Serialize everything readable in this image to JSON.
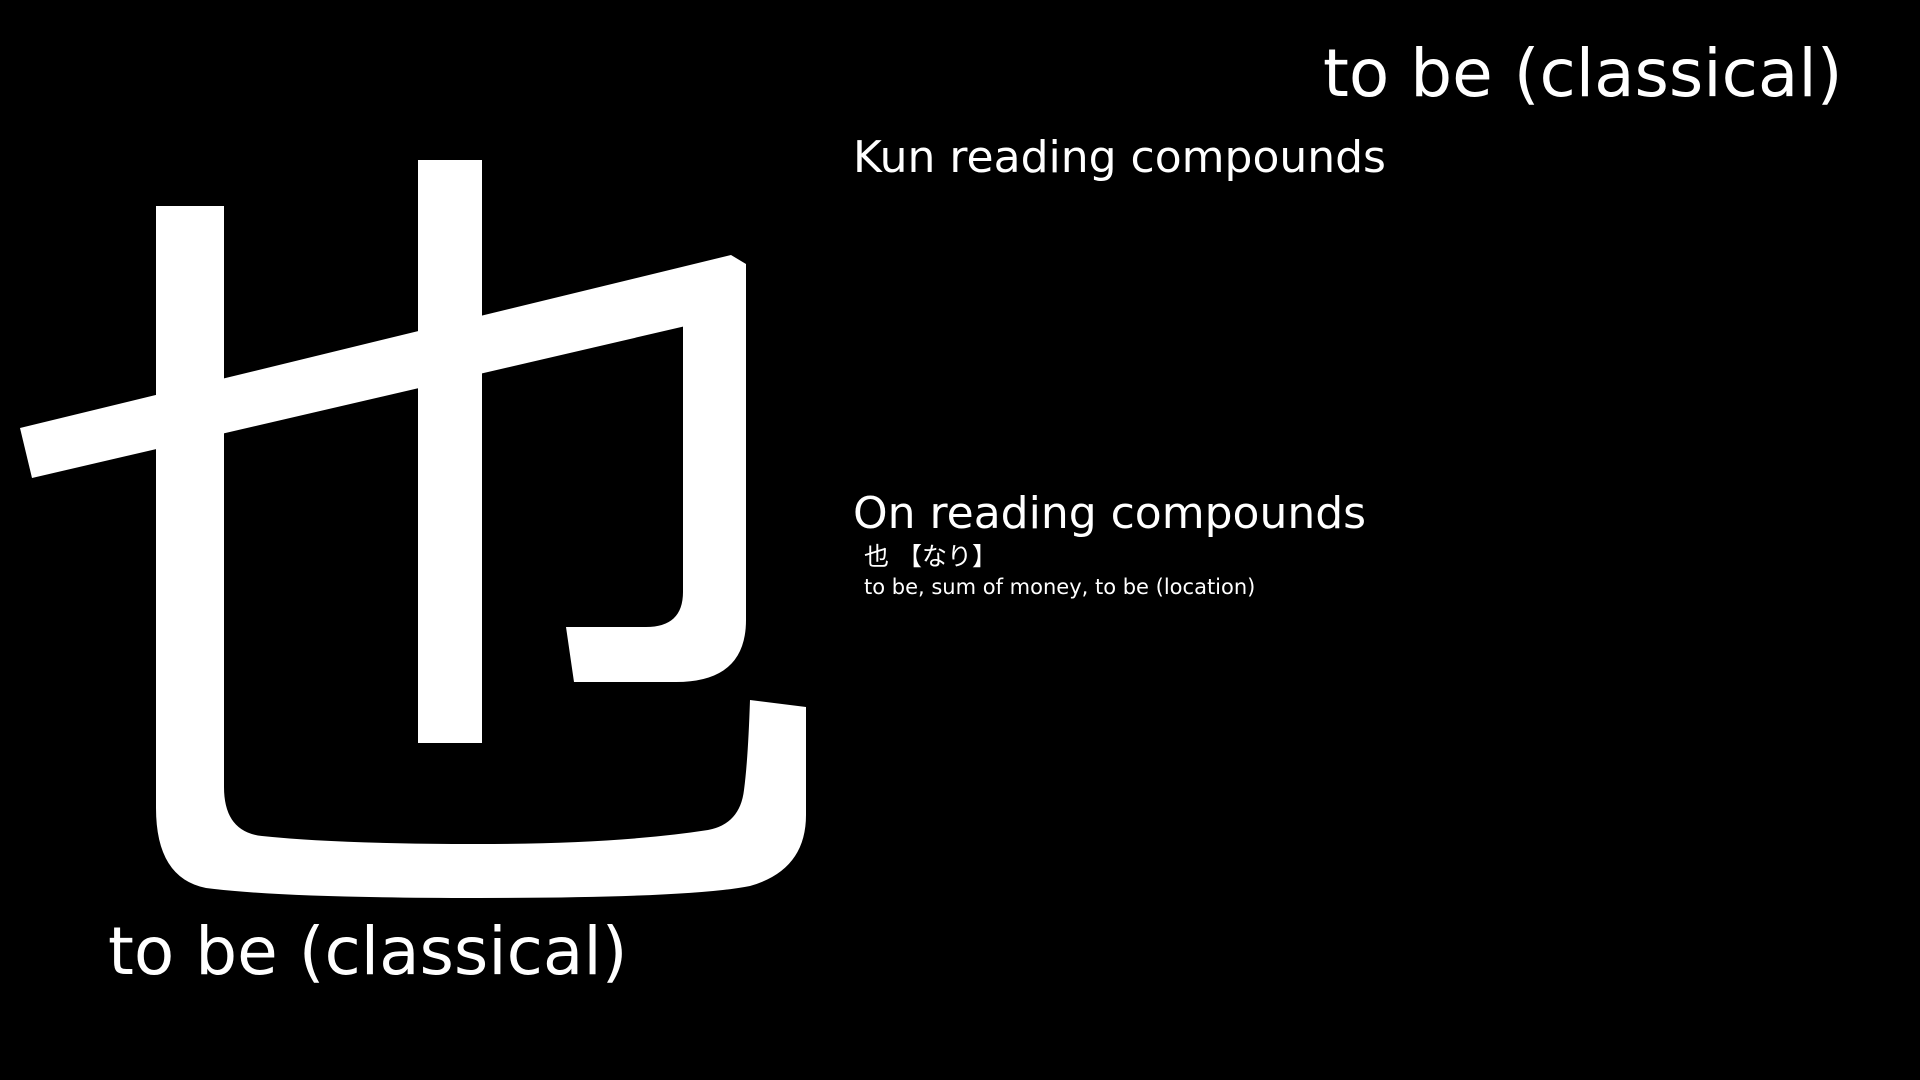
{
  "title_top": "to be (classical)",
  "kanji": {
    "character": "也",
    "color": "#ffffff"
  },
  "kun_heading": "Kun reading compounds",
  "on_heading": "On reading compounds",
  "on_compounds": [
    {
      "word": "也",
      "reading": "【なり】",
      "meaning": "to be, sum of money, to be (location)"
    }
  ],
  "title_bottom": "to be (classical)",
  "colors": {
    "background": "#000000",
    "text": "#ffffff"
  }
}
